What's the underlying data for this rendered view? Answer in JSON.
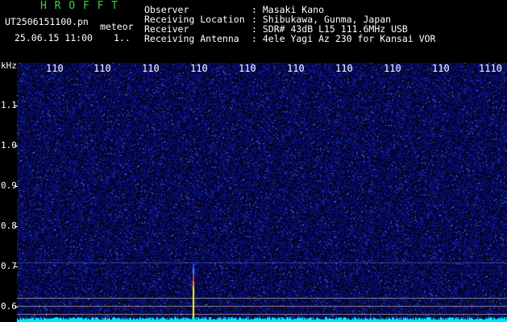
{
  "header": {
    "logo": "H R O F F T",
    "filename": "UT2506151100.pn",
    "tag": "meteor",
    "datetime": "25.06.15 11:00",
    "page_marker": "1..",
    "fields": [
      {
        "label": "Observer",
        "value": ": Masaki Kano"
      },
      {
        "label": "Receiving Location",
        "value": ": Shibukawa, Gunma, Japan"
      },
      {
        "label": "Receiver",
        "value": ": SDR# 43dB L15 111.6MHz USB"
      },
      {
        "label": "Receiving Antenna",
        "value": ": 4ele Yagi Az 230 for Kansai VOR"
      }
    ]
  },
  "axes": {
    "y_unit": "kHz",
    "y_labels": [
      "1.1",
      "1.0",
      "0.9",
      "0.8",
      "0.7",
      "0.6"
    ],
    "x_labels": [
      "110",
      "110",
      "110",
      "110",
      "110",
      "110",
      "110",
      "110",
      "110",
      "1110"
    ]
  },
  "colors": {
    "background": "#000000",
    "noise": "#1a1a8a",
    "baseline_trace": "#00e5ff",
    "meteor_head": "#ff3030",
    "meteor_trail": "#ffff00"
  }
}
